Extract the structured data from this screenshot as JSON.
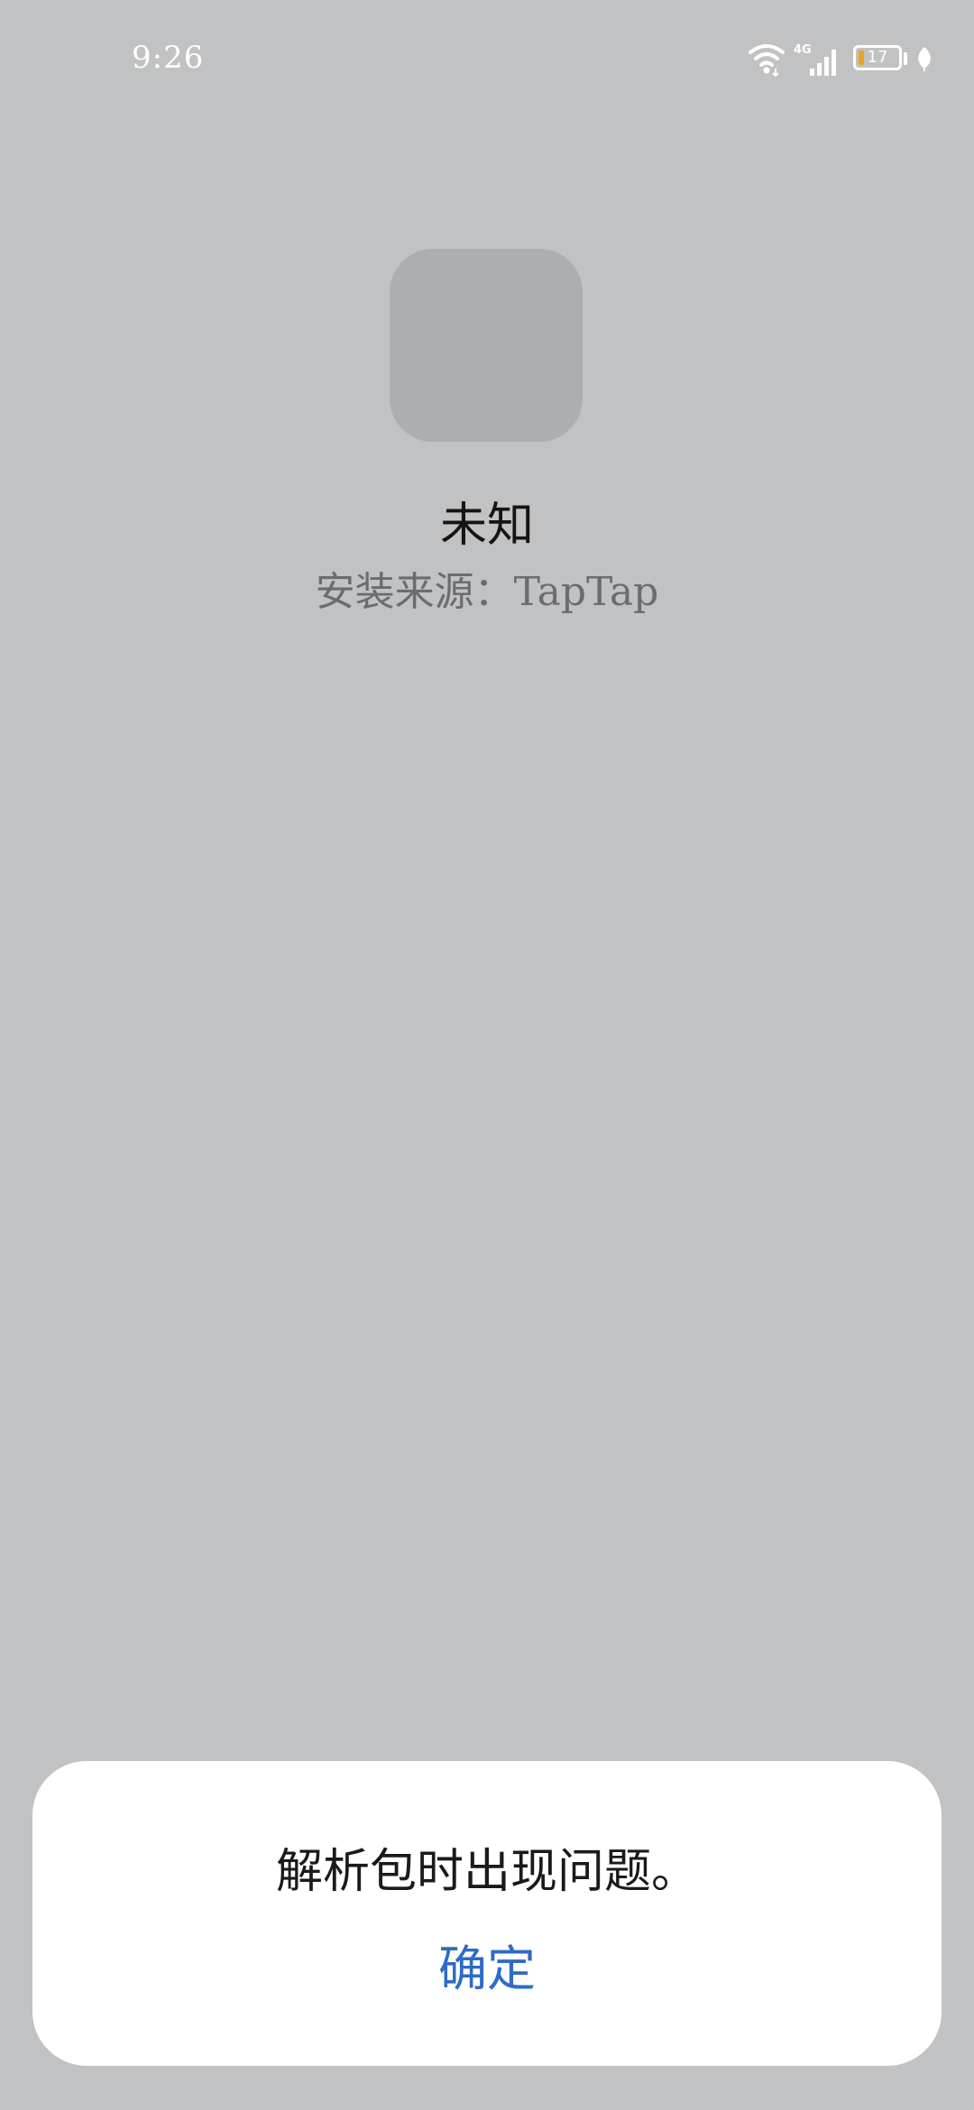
{
  "status_bar": {
    "time": "9:26",
    "network_label": "4G",
    "battery_level": "17",
    "battery_fraction": 0.17
  },
  "app": {
    "name": "未知",
    "install_source": "安装来源：TapTap"
  },
  "dialog": {
    "message": "解析包时出现问题。",
    "confirm_label": "确定"
  },
  "colors": {
    "background": "#c1c2c4",
    "accent": "#2f6bc4",
    "battery_fill": "#f0a024",
    "dialog_background": "#ffffff"
  },
  "icons": [
    "wifi-icon",
    "cellular-signal-icon",
    "battery-icon",
    "leaf-icon"
  ]
}
